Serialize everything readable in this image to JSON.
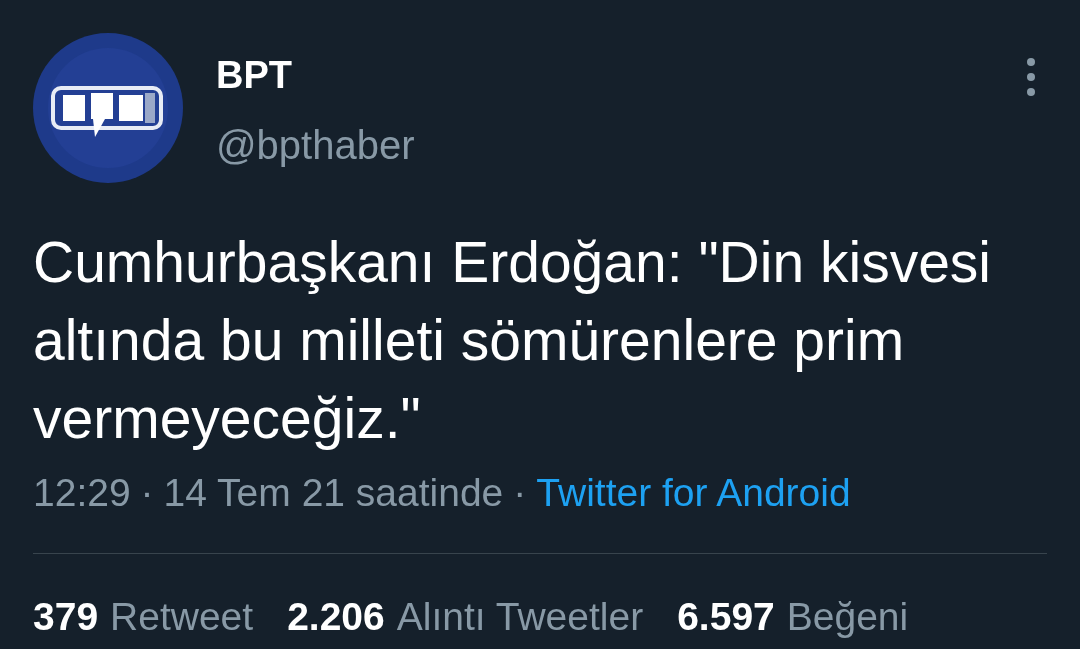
{
  "author": {
    "name": "BPT",
    "handle": "@bpthaber"
  },
  "tweet": {
    "text": "Cumhurbaşkanı Erdoğan: \"Din kisvesi altında bu milleti sömürenlere prim vermeyeceğiz.\""
  },
  "meta": {
    "time": "12:29",
    "separator_1": "·",
    "date": "14 Tem 21 saatinde",
    "separator_2": "·",
    "source": "Twitter for Android"
  },
  "stats": [
    {
      "count": "379",
      "label": "Retweet"
    },
    {
      "count": "2.206",
      "label": "Alıntı Tweetler"
    },
    {
      "count": "6.597",
      "label": "Beğeni"
    }
  ]
}
